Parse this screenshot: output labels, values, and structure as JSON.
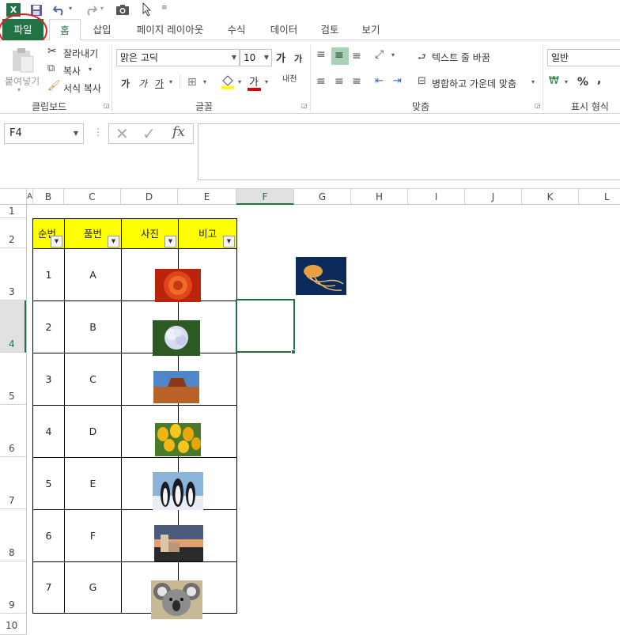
{
  "qat": {
    "icons": [
      "excel-logo-icon",
      "save-icon",
      "undo-icon",
      "redo-icon",
      "camera-icon",
      "cursor-icon",
      "customize-icon"
    ]
  },
  "tabs": [
    "파일",
    "홈",
    "삽입",
    "페이지 레이아웃",
    "수식",
    "데이터",
    "검토",
    "보기"
  ],
  "ribbon": {
    "clipboard": {
      "paste": "붙여넣기",
      "cut": "잘라내기",
      "copy": "복사",
      "format_painter": "서식 복사",
      "label": "클립보드"
    },
    "font": {
      "name": "맑은 고딕",
      "size": "10",
      "bold": "가",
      "italic": "가",
      "underline": "가",
      "grow": "가",
      "shrink": "가",
      "color_glyph": "가",
      "label": "글꼴"
    },
    "align": {
      "wrap": "텍스트 줄 바꿈",
      "merge": "병합하고 가운데 맞춤",
      "label": "맞춤",
      "orient": "내천"
    },
    "number": {
      "format": "일반",
      "percent": "%",
      "comma": ",",
      "label": "표시 형식"
    }
  },
  "formula_bar": {
    "name_box": "F4",
    "fx": "fx",
    "value": ""
  },
  "columns": [
    "A",
    "B",
    "C",
    "D",
    "E",
    "F",
    "G",
    "H",
    "I",
    "J",
    "K",
    "L"
  ],
  "rows": [
    "1",
    "2",
    "3",
    "4",
    "5",
    "6",
    "7",
    "8",
    "9",
    "10"
  ],
  "table": {
    "headers": [
      "순번",
      "품번",
      "사진",
      "비고"
    ],
    "rows": [
      {
        "no": "1",
        "code": "A",
        "photo": "flower"
      },
      {
        "no": "2",
        "code": "B",
        "photo": "hydrangea"
      },
      {
        "no": "3",
        "code": "C",
        "photo": "desert"
      },
      {
        "no": "4",
        "code": "D",
        "photo": "tulips"
      },
      {
        "no": "5",
        "code": "E",
        "photo": "penguins"
      },
      {
        "no": "6",
        "code": "F",
        "photo": "lighthouse"
      },
      {
        "no": "7",
        "code": "G",
        "photo": "koala"
      }
    ]
  },
  "floating_picture": "jellyfish",
  "colors": {
    "excel_green": "#217346",
    "header_yellow": "#ffff00",
    "annotation_red": "#e02020"
  }
}
